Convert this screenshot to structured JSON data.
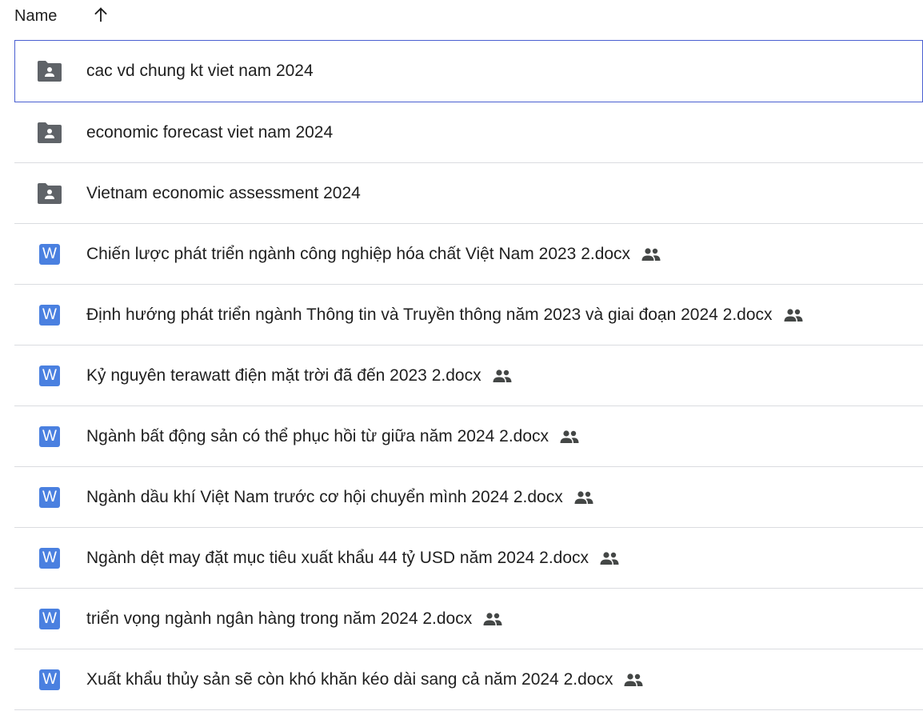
{
  "header": {
    "name_label": "Name",
    "sort_icon": "arrow-up-icon"
  },
  "items": [
    {
      "type": "folder",
      "icon": "shared-folder-icon",
      "name": "cac vd chung kt viet nam 2024",
      "shared": false,
      "selected": true
    },
    {
      "type": "folder",
      "icon": "shared-folder-icon",
      "name": "economic forecast viet nam 2024",
      "shared": false,
      "selected": false
    },
    {
      "type": "folder",
      "icon": "shared-folder-icon",
      "name": "Vietnam economic assessment 2024",
      "shared": false,
      "selected": false
    },
    {
      "type": "docx",
      "icon": "word-icon",
      "icon_letter": "W",
      "name": "Chiến lược phát triển ngành công nghiệp hóa chất Việt Nam 2023 2.docx",
      "shared": true,
      "selected": false
    },
    {
      "type": "docx",
      "icon": "word-icon",
      "icon_letter": "W",
      "name": "Định hướng phát triển ngành Thông tin và Truyền thông năm 2023 và giai đoạn 2024 2.docx",
      "shared": true,
      "selected": false
    },
    {
      "type": "docx",
      "icon": "word-icon",
      "icon_letter": "W",
      "name": "Kỷ nguyên terawatt điện mặt trời đã đến 2023 2.docx",
      "shared": true,
      "selected": false
    },
    {
      "type": "docx",
      "icon": "word-icon",
      "icon_letter": "W",
      "name": "Ngành bất động sản có thể phục hồi từ giữa năm 2024 2.docx",
      "shared": true,
      "selected": false
    },
    {
      "type": "docx",
      "icon": "word-icon",
      "icon_letter": "W",
      "name": "Ngành dầu khí Việt Nam trước cơ hội chuyển mình 2024 2.docx",
      "shared": true,
      "selected": false
    },
    {
      "type": "docx",
      "icon": "word-icon",
      "icon_letter": "W",
      "name": "Ngành dệt may đặt mục tiêu xuất khẩu 44 tỷ USD năm 2024 2.docx",
      "shared": true,
      "selected": false
    },
    {
      "type": "docx",
      "icon": "word-icon",
      "icon_letter": "W",
      "name": "triển vọng ngành ngân hàng trong năm 2024 2.docx",
      "shared": true,
      "selected": false
    },
    {
      "type": "docx",
      "icon": "word-icon",
      "icon_letter": "W",
      "name": "Xuất khẩu thủy sản sẽ còn khó khăn kéo dài sang cả năm 2024 2.docx",
      "shared": true,
      "selected": false
    }
  ],
  "colors": {
    "word_blue": "#4a80e0",
    "folder_gray": "#5f6368",
    "selected_border": "#4a5fd1",
    "divider": "#dadce0",
    "text": "#1f1f1f"
  }
}
